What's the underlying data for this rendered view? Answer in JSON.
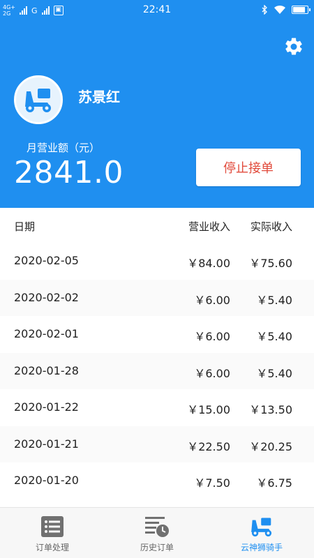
{
  "status_bar": {
    "network_top": "4G+",
    "network_bottom": "2G",
    "network_alt": "G",
    "time": "22:41",
    "battery_percent": 85
  },
  "header": {
    "username": "苏景红",
    "month_revenue_label": "月营业额（元）",
    "month_revenue_value": "2841.0",
    "stop_button_label": "停止接单"
  },
  "table": {
    "headers": {
      "date": "日期",
      "revenue": "营业收入",
      "actual": "实际收入"
    },
    "rows": [
      {
        "date": "2020-02-05",
        "revenue": "￥84.00",
        "actual": "￥75.60"
      },
      {
        "date": "2020-02-02",
        "revenue": "￥6.00",
        "actual": "￥5.40"
      },
      {
        "date": "2020-02-01",
        "revenue": "￥6.00",
        "actual": "￥5.40"
      },
      {
        "date": "2020-01-28",
        "revenue": "￥6.00",
        "actual": "￥5.40"
      },
      {
        "date": "2020-01-22",
        "revenue": "￥15.00",
        "actual": "￥13.50"
      },
      {
        "date": "2020-01-21",
        "revenue": "￥22.50",
        "actual": "￥20.25"
      },
      {
        "date": "2020-01-20",
        "revenue": "￥7.50",
        "actual": "￥6.75"
      }
    ]
  },
  "bottom_nav": {
    "items": [
      {
        "label": "订单处理",
        "icon": "list-icon",
        "active": false
      },
      {
        "label": "历史订单",
        "icon": "history-icon",
        "active": false
      },
      {
        "label": "云神狮骑手",
        "icon": "scooter-icon",
        "active": true
      }
    ]
  },
  "colors": {
    "primary": "#1f8ff0",
    "stop_button_text": "#e14a3b",
    "inactive_icon": "#707070"
  }
}
